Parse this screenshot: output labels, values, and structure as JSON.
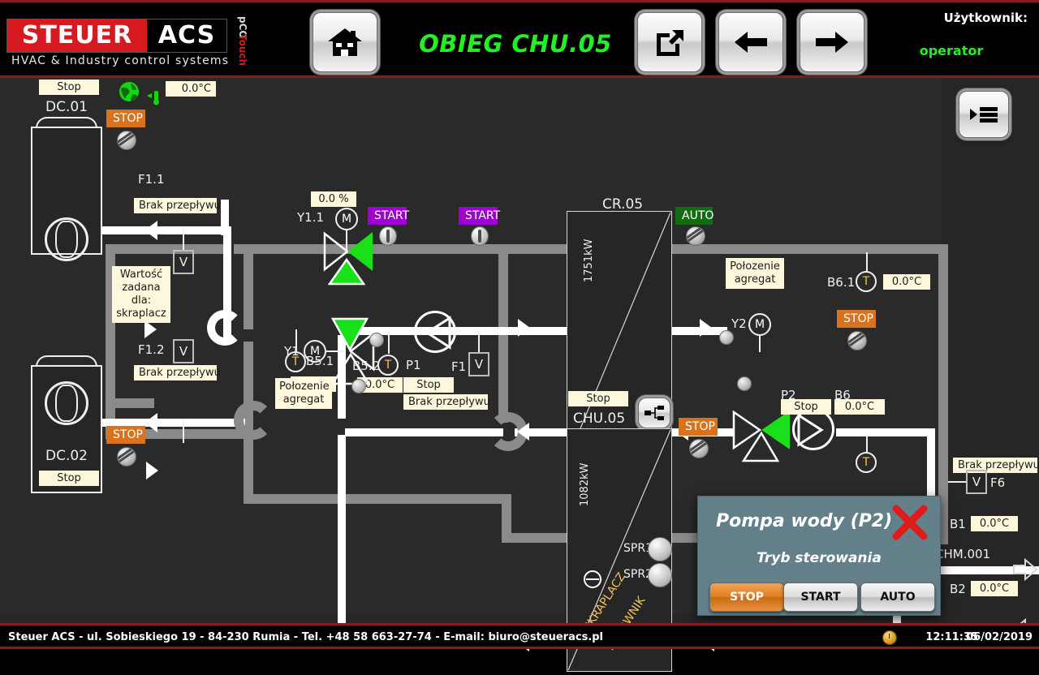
{
  "brand": {
    "name_red": "STEUER",
    "name_black": "ACS",
    "tagline": "HVAC  &  Industry  control  systems",
    "pco_gray": "pCO",
    "pco_red": "Touch"
  },
  "header": {
    "title": "OBIEG CHU.05",
    "home_icon": "home-icon",
    "export_icon": "external-link-icon",
    "back_icon": "arrow-left-icon",
    "forward_icon": "arrow-right-icon",
    "user_label": "Użytkownik:",
    "user_value": "operator",
    "menu_icon": "list-menu-icon",
    "accent_green": "#22f022",
    "accent_red": "#8d1b1b"
  },
  "ambient": {
    "globe_icon": "globe-icon",
    "thermometer_icon": "thermometer-icon",
    "temperature": "0.0°C"
  },
  "chillers": [
    {
      "name": "DC.01",
      "status": "Stop",
      "mode_badge": "STOP",
      "knob_icon": "rotary-knob-icon"
    },
    {
      "name": "DC.02",
      "status": "Stop",
      "mode_badge": "STOP",
      "knob_icon": "rotary-knob-icon"
    }
  ],
  "flow_switches": [
    {
      "tag": "F1.1",
      "symbol": "V",
      "status": "Brak przepływu"
    },
    {
      "tag": "F1.2",
      "symbol": "V",
      "status": "Brak przepływu"
    },
    {
      "tag": "F1",
      "symbol": "V",
      "status": "Brak przepływu"
    },
    {
      "tag": "F6",
      "symbol": "V",
      "status": "Brak przepływu"
    }
  ],
  "setpoint_note": "Wartość\nzadana dla:\nskraplacz",
  "setpoint_note_lines": [
    "Wartość",
    "zadana dla:",
    "skraplacz"
  ],
  "valves": [
    {
      "tag": "Y1.1",
      "actuator": "M",
      "position": "0.0 %",
      "note_lines": []
    },
    {
      "tag": "Y1",
      "actuator": "M",
      "position": "",
      "note_lines": [
        "Połozenie",
        "agregat"
      ]
    },
    {
      "tag": "Y2",
      "actuator": "M",
      "position": "",
      "note_lines": [
        "Połozenie",
        "agregat"
      ]
    }
  ],
  "sensors": [
    {
      "tag": "B5.1",
      "symbol": "T",
      "value": "0.0°C"
    },
    {
      "tag": "B5.2",
      "symbol": "T",
      "value": "0.0°C"
    },
    {
      "tag": "B6.1",
      "symbol": "T",
      "value": "0.0°C"
    },
    {
      "tag": "B6",
      "symbol": "T",
      "value": "0.0°C"
    },
    {
      "tag": "B1",
      "symbol": "",
      "value": "0.0°C"
    },
    {
      "tag": "B2",
      "symbol": "",
      "value": "0.0°C"
    }
  ],
  "pumps": [
    {
      "tag": "P1",
      "status": "Stop",
      "flow_status": "Brak przepływu",
      "badge": "START",
      "switch_icon": "toggle-switch-icon"
    },
    {
      "tag": "P2",
      "status": "Stop",
      "flow_status": "",
      "badge": "STOP",
      "switch_icon": "rotary-knob-icon"
    }
  ],
  "extra_badges": {
    "start_left": "START",
    "start_right": "START",
    "auto": "AUTO",
    "stop_chu": "STOP"
  },
  "exchangers": [
    {
      "name": "CR.05",
      "power": "1751kW",
      "status": "",
      "diag_labels": []
    },
    {
      "name": "CHU.05",
      "power": "1082kW",
      "status": "Stop",
      "diag_labels": [
        "SKRAPLACZ",
        "PAROWNIK"
      ]
    }
  ],
  "compressors": [
    {
      "tag": "SPR1",
      "led": "off"
    },
    {
      "tag": "SPR2",
      "led": "off"
    }
  ],
  "circuit_label": "CHM.001",
  "chu_network_icon": "network-node-icon",
  "dialog": {
    "title": "Pompa wody (P2)",
    "subtitle": "Tryb sterowania",
    "close_icon": "close-x-icon",
    "buttons": [
      {
        "label": "STOP",
        "state": "active"
      },
      {
        "label": "START",
        "state": "normal"
      },
      {
        "label": "AUTO",
        "state": "normal"
      }
    ]
  },
  "footer": {
    "text": "Steuer ACS - ul. Sobieskiego 19 - 84-230 Rumia - Tel. +48 58 663-27-74 - E-mail: biuro@steueracs.pl",
    "clock_icon": "clock-icon",
    "time": "12:11:35",
    "date": "06/02/2019"
  }
}
